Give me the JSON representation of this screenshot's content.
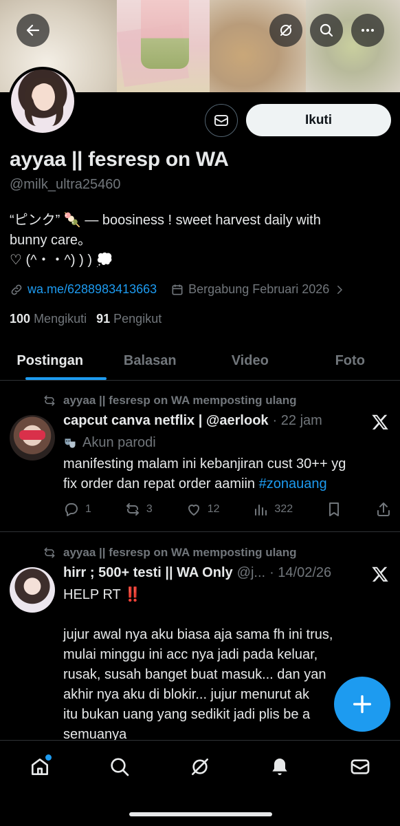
{
  "profile": {
    "name": "ayyaa || fesresp on WA",
    "handle": "@milk_ultra25460",
    "bio_line1": "“ピンク” 🍡 — boosiness ! sweet harvest daily with",
    "bio_line2": "bunny care。",
    "bio_line3": "♡ (^・・^) ) ) 💭",
    "link": "wa.me/6288983413663",
    "joined": "Bergabung Februari 2026",
    "following_count": "100",
    "following_label": "Mengikuti",
    "followers_count": "91",
    "followers_label": "Pengikut"
  },
  "header": {
    "follow_label": "Ikuti"
  },
  "tabs": [
    {
      "label": "Postingan"
    },
    {
      "label": "Balasan"
    },
    {
      "label": "Video"
    },
    {
      "label": "Foto"
    }
  ],
  "posts": [
    {
      "repost_text": "ayyaa || fesresp on WA memposting ulang",
      "author": "capcut canva netflix | @aerlook",
      "time": "· 22 jam",
      "parody_label": "Akun parodi",
      "text_line1": "manifesting malam ini kebanjiran cust 30++ yg",
      "text_line2_prefix": "fix order dan repat order aamiin ",
      "hashtag": "#zonauang",
      "replies": "1",
      "reposts": "3",
      "likes": "12",
      "views": "322"
    },
    {
      "repost_text": "ayyaa || fesresp on WA memposting ulang",
      "author": "hirr ; 500+ testi || WA Only",
      "handle_trunc": "@j...",
      "time": "· 14/02/26",
      "text_line1": "HELP RT ‼️",
      "text_body": [
        "jujur awal nya aku biasa aja sama fh ini trus,",
        "mulai minggu ini acc nya jadi pada keluar,",
        "rusak, susah banget buat masuk... dan yan",
        "akhir nya aku di blokir... jujur menurut ak",
        "itu bukan uang yang sedikit jadi plis be a",
        "semuanya"
      ]
    }
  ],
  "colors": {
    "accent": "#1d9bf0",
    "muted": "#71767b",
    "text": "#e7e9ea",
    "border": "#2f3336"
  },
  "icons": {
    "back": "arrow-left-icon",
    "grok": "grok-icon",
    "search": "search-icon",
    "more": "more-icon",
    "message": "envelope-icon",
    "link": "link-icon",
    "calendar": "calendar-icon",
    "repost": "repost-icon",
    "x_logo": "x-logo-icon",
    "fab": "plus-icon"
  }
}
